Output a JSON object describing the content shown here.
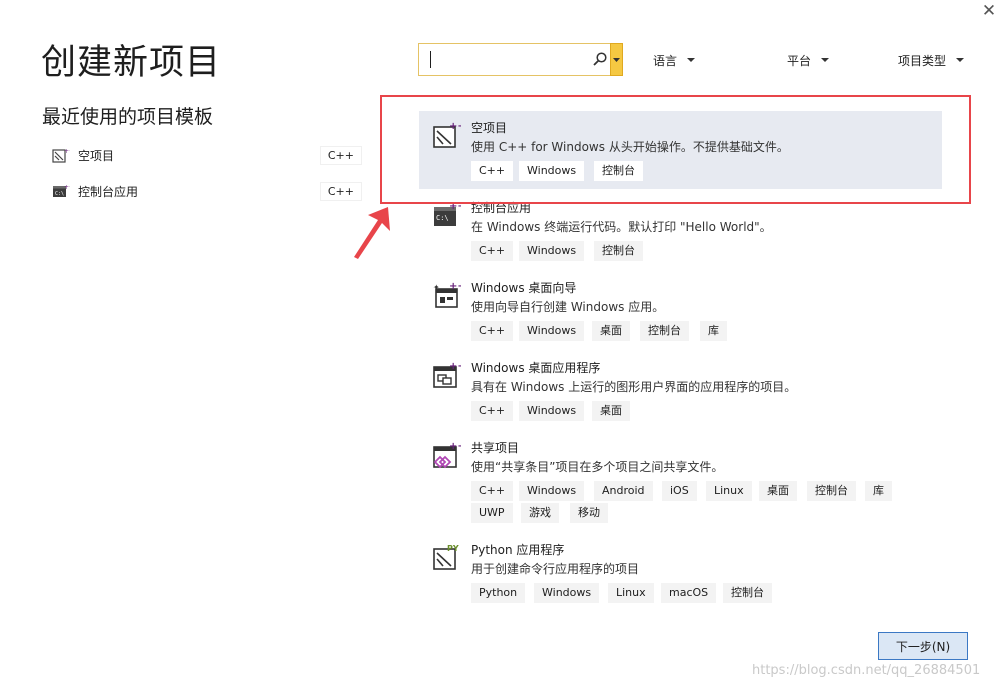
{
  "window": {
    "close_glyph": "✕"
  },
  "page": {
    "title": "创建新项目"
  },
  "recent": {
    "title": "最近使用的项目模板",
    "items": [
      {
        "label": "空项目",
        "tag": "C++",
        "icon": "empty-project-icon"
      },
      {
        "label": "控制台应用",
        "tag": "C++",
        "icon": "console-app-icon"
      }
    ]
  },
  "search": {
    "value": "",
    "placeholder": "",
    "icon": "search-icon"
  },
  "filters": {
    "language": "语言",
    "platform": "平台",
    "project_type": "项目类型"
  },
  "templates": [
    {
      "title": "空项目",
      "desc": "使用 C++ for Windows 从头开始操作。不提供基础文件。",
      "tags": [
        "C++",
        "Windows",
        "控制台"
      ],
      "icon": "empty-project-icon",
      "selected": true
    },
    {
      "title": "控制台应用",
      "desc": "在 Windows 终端运行代码。默认打印 \"Hello World\"。",
      "tags": [
        "C++",
        "Windows",
        "控制台"
      ],
      "icon": "console-app-icon"
    },
    {
      "title": "Windows 桌面向导",
      "desc": "使用向导自行创建 Windows 应用。",
      "tags": [
        "C++",
        "Windows",
        "桌面",
        "控制台",
        "库"
      ],
      "icon": "wizard-icon"
    },
    {
      "title": "Windows 桌面应用程序",
      "desc": "具有在 Windows 上运行的图形用户界面的应用程序的项目。",
      "tags": [
        "C++",
        "Windows",
        "桌面"
      ],
      "icon": "desktop-app-icon"
    },
    {
      "title": "共享项目",
      "desc": "使用“共享条目”项目在多个项目之间共享文件。",
      "tags": [
        "C++",
        "Windows",
        "Android",
        "iOS",
        "Linux",
        "桌面",
        "控制台",
        "库",
        "UWP",
        "游戏",
        "移动"
      ],
      "icon": "shared-project-icon"
    },
    {
      "title": "Python 应用程序",
      "desc": "用于创建命令行应用程序的项目",
      "tags": [
        "Python",
        "Windows",
        "Linux",
        "macOS",
        "控制台"
      ],
      "icon": "python-app-icon"
    }
  ],
  "buttons": {
    "next": "下一步(N)"
  },
  "watermark": "https://blog.csdn.net/qq_26884501",
  "colors": {
    "selection_bg": "#e7eaf1",
    "annotation_red": "#e8454a",
    "primary_border": "#3b78c4",
    "search_border": "#e5c365"
  }
}
